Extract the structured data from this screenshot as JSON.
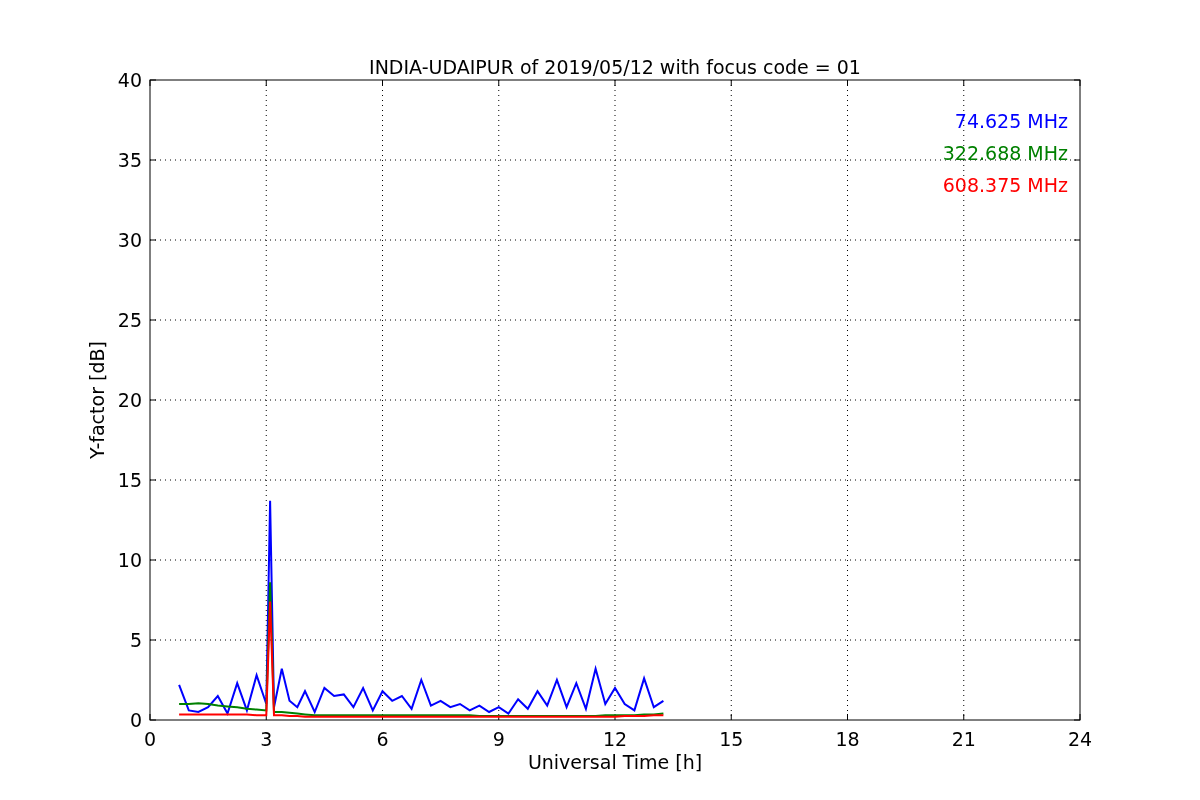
{
  "chart_data": {
    "type": "line",
    "title": "INDIA-UDAIPUR of 2019/05/12 with focus code = 01",
    "xlabel": "Universal Time [h]",
    "ylabel": "Y-factor [dB]",
    "x": [
      0.75,
      1.0,
      1.25,
      1.5,
      1.75,
      2.0,
      2.25,
      2.5,
      2.75,
      3.0,
      3.1,
      3.2,
      3.4,
      3.6,
      3.8,
      4.0,
      4.25,
      4.5,
      4.75,
      5.0,
      5.25,
      5.5,
      5.75,
      6.0,
      6.25,
      6.5,
      6.75,
      7.0,
      7.25,
      7.5,
      7.75,
      8.0,
      8.25,
      8.5,
      8.75,
      9.0,
      9.25,
      9.5,
      9.75,
      10.0,
      10.25,
      10.5,
      10.75,
      11.0,
      11.25,
      11.5,
      11.75,
      12.0,
      12.25,
      12.5,
      12.75,
      13.0,
      13.25
    ],
    "series": [
      {
        "name": "74.625 MHz",
        "color": "#0000ff",
        "values": [
          2.2,
          0.6,
          0.5,
          0.8,
          1.5,
          0.4,
          2.3,
          0.6,
          2.8,
          1.0,
          13.7,
          0.8,
          3.2,
          1.2,
          0.8,
          1.8,
          0.5,
          2.0,
          1.5,
          1.6,
          0.8,
          2.0,
          0.6,
          1.8,
          1.2,
          1.5,
          0.7,
          2.5,
          0.9,
          1.2,
          0.8,
          1.0,
          0.6,
          0.9,
          0.5,
          0.8,
          0.4,
          1.3,
          0.7,
          1.8,
          0.9,
          2.5,
          0.8,
          2.3,
          0.7,
          3.2,
          1.0,
          2.0,
          1.0,
          0.6,
          2.6,
          0.8,
          1.2
        ]
      },
      {
        "name": "322.688 MHz",
        "color": "#008000",
        "values": [
          1.0,
          1.0,
          1.05,
          1.0,
          0.9,
          0.85,
          0.8,
          0.7,
          0.65,
          0.6,
          8.6,
          0.5,
          0.5,
          0.45,
          0.4,
          0.35,
          0.3,
          0.3,
          0.3,
          0.3,
          0.3,
          0.3,
          0.3,
          0.3,
          0.3,
          0.3,
          0.3,
          0.3,
          0.3,
          0.3,
          0.3,
          0.3,
          0.3,
          0.25,
          0.25,
          0.25,
          0.25,
          0.25,
          0.25,
          0.25,
          0.25,
          0.25,
          0.25,
          0.25,
          0.25,
          0.25,
          0.3,
          0.3,
          0.3,
          0.3,
          0.35,
          0.35,
          0.4
        ]
      },
      {
        "name": "608.375 MHz",
        "color": "#ff0000",
        "values": [
          0.35,
          0.35,
          0.35,
          0.35,
          0.35,
          0.35,
          0.35,
          0.35,
          0.3,
          0.3,
          7.4,
          0.3,
          0.3,
          0.25,
          0.25,
          0.2,
          0.2,
          0.2,
          0.2,
          0.2,
          0.2,
          0.2,
          0.2,
          0.2,
          0.2,
          0.2,
          0.2,
          0.2,
          0.2,
          0.2,
          0.2,
          0.2,
          0.2,
          0.2,
          0.2,
          0.2,
          0.2,
          0.2,
          0.2,
          0.2,
          0.2,
          0.2,
          0.2,
          0.2,
          0.2,
          0.2,
          0.2,
          0.2,
          0.25,
          0.25,
          0.25,
          0.3,
          0.3
        ]
      }
    ],
    "grid": true,
    "xlim": [
      0,
      24
    ],
    "ylim": [
      0,
      40
    ],
    "xticks": [
      0,
      3,
      6,
      9,
      12,
      15,
      18,
      21,
      24
    ],
    "yticks": [
      0,
      5,
      10,
      15,
      20,
      25,
      30,
      35,
      40
    ]
  }
}
